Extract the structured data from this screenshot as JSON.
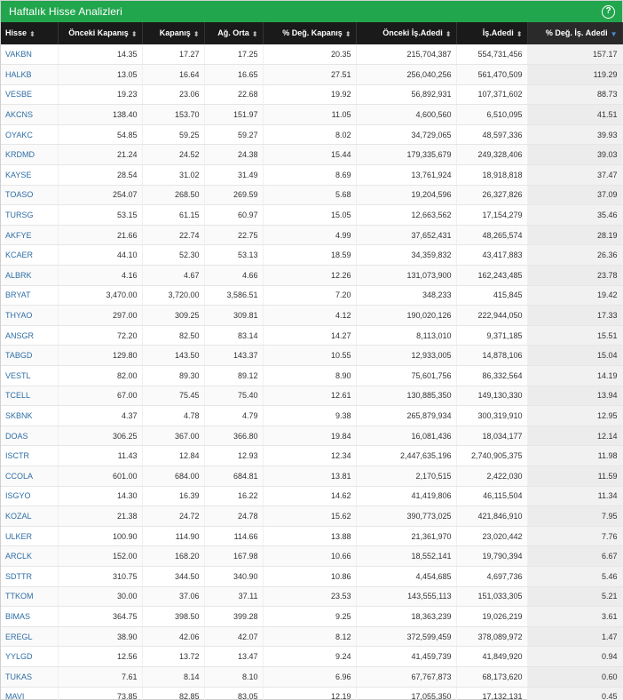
{
  "header": {
    "title": "Haftalık Hisse Analizleri",
    "help_label": "?"
  },
  "columns": [
    {
      "label": "Hisse",
      "sort": "both"
    },
    {
      "label": "Önceki Kapanış",
      "sort": "both"
    },
    {
      "label": "Kapanış",
      "sort": "both"
    },
    {
      "label": "Ağ. Orta",
      "sort": "both"
    },
    {
      "label": "% Değ. Kapanış",
      "sort": "both"
    },
    {
      "label": "Önceki İş.Adedi",
      "sort": "both"
    },
    {
      "label": "İş.Adedi",
      "sort": "both"
    },
    {
      "label": "% Değ. İş. Adedi",
      "sort": "desc"
    }
  ],
  "rows": [
    [
      "VAKBN",
      "14.35",
      "17.27",
      "17.25",
      "20.35",
      "215,704,387",
      "554,731,456",
      "157.17"
    ],
    [
      "HALKB",
      "13.05",
      "16.64",
      "16.65",
      "27.51",
      "256,040,256",
      "561,470,509",
      "119.29"
    ],
    [
      "VESBE",
      "19.23",
      "23.06",
      "22.68",
      "19.92",
      "56,892,931",
      "107,371,602",
      "88.73"
    ],
    [
      "AKCNS",
      "138.40",
      "153.70",
      "151.97",
      "11.05",
      "4,600,560",
      "6,510,095",
      "41.51"
    ],
    [
      "OYAKC",
      "54.85",
      "59.25",
      "59.27",
      "8.02",
      "34,729,065",
      "48,597,336",
      "39.93"
    ],
    [
      "KRDMD",
      "21.24",
      "24.52",
      "24.38",
      "15.44",
      "179,335,679",
      "249,328,406",
      "39.03"
    ],
    [
      "KAYSE",
      "28.54",
      "31.02",
      "31.49",
      "8.69",
      "13,761,924",
      "18,918,818",
      "37.47"
    ],
    [
      "TOASO",
      "254.07",
      "268.50",
      "269.59",
      "5.68",
      "19,204,596",
      "26,327,826",
      "37.09"
    ],
    [
      "TURSG",
      "53.15",
      "61.15",
      "60.97",
      "15.05",
      "12,663,562",
      "17,154,279",
      "35.46"
    ],
    [
      "AKFYE",
      "21.66",
      "22.74",
      "22.75",
      "4.99",
      "37,652,431",
      "48,265,574",
      "28.19"
    ],
    [
      "KCAER",
      "44.10",
      "52.30",
      "53.13",
      "18.59",
      "34,359,832",
      "43,417,883",
      "26.36"
    ],
    [
      "ALBRK",
      "4.16",
      "4.67",
      "4.66",
      "12.26",
      "131,073,900",
      "162,243,485",
      "23.78"
    ],
    [
      "BRYAT",
      "3,470.00",
      "3,720.00",
      "3,586.51",
      "7.20",
      "348,233",
      "415,845",
      "19.42"
    ],
    [
      "THYAO",
      "297.00",
      "309.25",
      "309.81",
      "4.12",
      "190,020,126",
      "222,944,050",
      "17.33"
    ],
    [
      "ANSGR",
      "72.20",
      "82.50",
      "83.14",
      "14.27",
      "8,113,010",
      "9,371,185",
      "15.51"
    ],
    [
      "TABGD",
      "129.80",
      "143.50",
      "143.37",
      "10.55",
      "12,933,005",
      "14,878,106",
      "15.04"
    ],
    [
      "VESTL",
      "82.00",
      "89.30",
      "89.12",
      "8.90",
      "75,601,756",
      "86,332,564",
      "14.19"
    ],
    [
      "TCELL",
      "67.00",
      "75.45",
      "75.40",
      "12.61",
      "130,885,350",
      "149,130,330",
      "13.94"
    ],
    [
      "SKBNK",
      "4.37",
      "4.78",
      "4.79",
      "9.38",
      "265,879,934",
      "300,319,910",
      "12.95"
    ],
    [
      "DOAS",
      "306.25",
      "367.00",
      "366.80",
      "19.84",
      "16,081,436",
      "18,034,177",
      "12.14"
    ],
    [
      "ISCTR",
      "11.43",
      "12.84",
      "12.93",
      "12.34",
      "2,447,635,196",
      "2,740,905,375",
      "11.98"
    ],
    [
      "CCOLA",
      "601.00",
      "684.00",
      "684.81",
      "13.81",
      "2,170,515",
      "2,422,030",
      "11.59"
    ],
    [
      "ISGYO",
      "14.30",
      "16.39",
      "16.22",
      "14.62",
      "41,419,806",
      "46,115,504",
      "11.34"
    ],
    [
      "KOZAL",
      "21.38",
      "24.72",
      "24.78",
      "15.62",
      "390,773,025",
      "421,846,910",
      "7.95"
    ],
    [
      "ULKER",
      "100.90",
      "114.90",
      "114.66",
      "13.88",
      "21,361,970",
      "23,020,442",
      "7.76"
    ],
    [
      "ARCLK",
      "152.00",
      "168.20",
      "167.98",
      "10.66",
      "18,552,141",
      "19,790,394",
      "6.67"
    ],
    [
      "SDTTR",
      "310.75",
      "344.50",
      "340.90",
      "10.86",
      "4,454,685",
      "4,697,736",
      "5.46"
    ],
    [
      "TTKOM",
      "30.00",
      "37.06",
      "37.11",
      "23.53",
      "143,555,113",
      "151,033,305",
      "5.21"
    ],
    [
      "BIMAS",
      "364.75",
      "398.50",
      "399.28",
      "9.25",
      "18,363,239",
      "19,026,219",
      "3.61"
    ],
    [
      "EREGL",
      "38.90",
      "42.06",
      "42.07",
      "8.12",
      "372,599,459",
      "378,089,972",
      "1.47"
    ],
    [
      "YYLGD",
      "12.56",
      "13.72",
      "13.47",
      "9.24",
      "41,459,739",
      "41,849,920",
      "0.94"
    ],
    [
      "TUKAS",
      "7.61",
      "8.14",
      "8.10",
      "6.96",
      "67,767,873",
      "68,173,620",
      "0.60"
    ],
    [
      "MAVI",
      "73.85",
      "82.85",
      "83.05",
      "12.19",
      "17,055,350",
      "17,132,131",
      "0.45"
    ]
  ],
  "colors": {
    "header_bg": "#21a64d",
    "table_head_bg": "#1a1a1a",
    "link": "#2e6da4"
  },
  "icons": {
    "sort_both": "▲▼",
    "sort_desc": "▼"
  }
}
